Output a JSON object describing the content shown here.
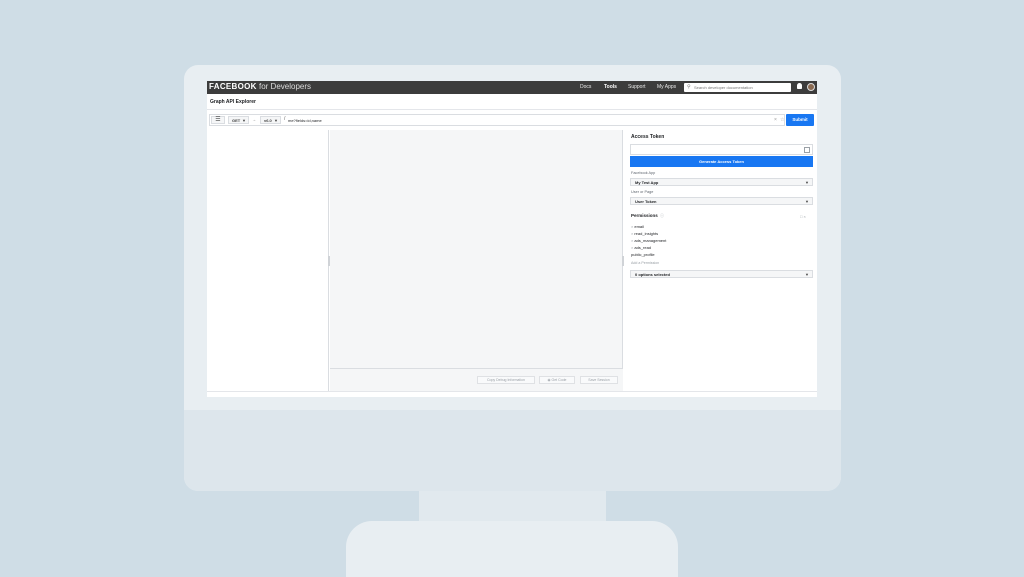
{
  "header": {
    "logo_brand": "FACEBOOK",
    "logo_suffix": "for Developers",
    "nav": [
      "Docs",
      "Tools",
      "Support",
      "My Apps"
    ],
    "search_placeholder": "Search developer documentation"
  },
  "page_title": "Graph API Explorer",
  "query": {
    "method": "GET",
    "version": "v6.0",
    "path": "me?fields=id,name",
    "submit_label": "Submit"
  },
  "center_footer": {
    "copy_debug_label": "Copy Debug Information",
    "get_code_label": "Get Code",
    "save_session_label": "Save Session"
  },
  "access_panel": {
    "title": "Access Token",
    "generate_label": "Generate Access Token",
    "facebook_app_label": "Facebook App",
    "facebook_app_value": "My Test App",
    "user_or_page_label": "User or Page",
    "user_or_page_value": "User Token",
    "permissions_title": "Permissions",
    "permissions": [
      "email",
      "read_insights",
      "ads_management",
      "ads_read",
      "public_profile"
    ],
    "add_permission_label": "Add a Permission",
    "options_selected": "0 options selected"
  },
  "colors": {
    "accent": "#1877f2",
    "topbar": "#3c3c3c",
    "background": "#cfdde6"
  }
}
